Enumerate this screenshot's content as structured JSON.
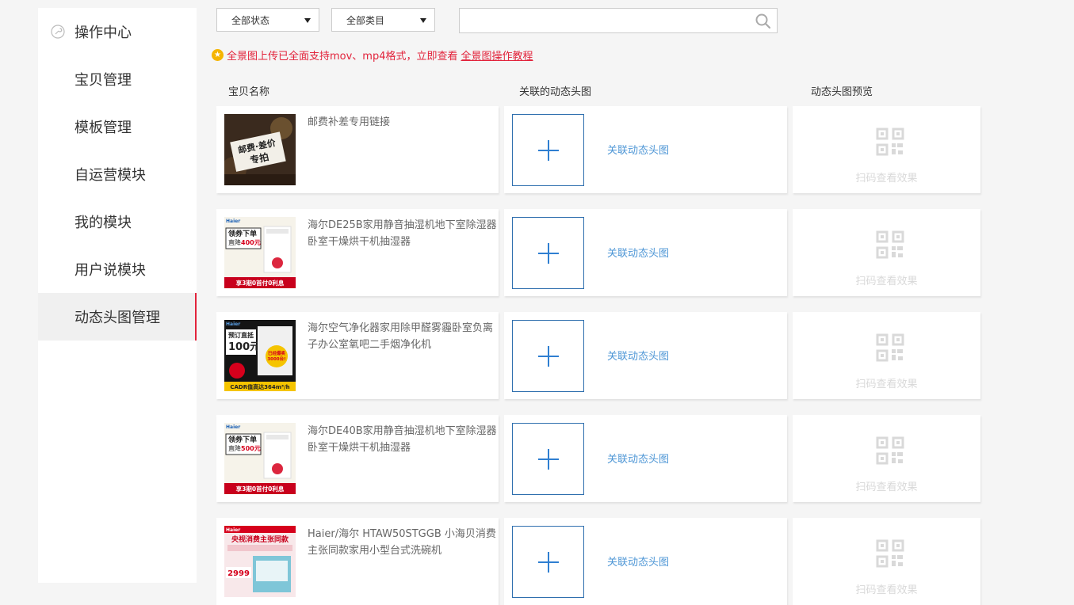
{
  "sidebar": {
    "items": [
      {
        "label": "操作中心"
      },
      {
        "label": "宝贝管理"
      },
      {
        "label": "模板管理"
      },
      {
        "label": "自运营模块"
      },
      {
        "label": "我的模块"
      },
      {
        "label": "用户说模块"
      },
      {
        "label": "动态头图管理"
      }
    ],
    "active_index": 6
  },
  "filters": {
    "status_select": "全部状态",
    "category_select": "全部类目",
    "search_placeholder": ""
  },
  "notice": {
    "text": "全景图上传已全面支持mov、mp4格式，立即查看",
    "link": "全景图操作教程"
  },
  "table": {
    "headers": [
      "宝贝名称",
      "关联的动态头图",
      "动态头图预览"
    ],
    "link_label": "关联动态头图",
    "preview_label": "扫码查看效果",
    "rows": [
      {
        "name": "邮费补差专用链接",
        "thumb": {
          "type": "postage",
          "line1": "邮费·差价",
          "line2": "专拍"
        }
      },
      {
        "name": "海尔DE25B家用静音抽湿机地下室除湿器卧室干燥烘干机抽湿器",
        "thumb": {
          "type": "dehumid",
          "brand": "Haier",
          "badge": "领券下单",
          "line2": "直降",
          "amount": "400元",
          "bottom": "享3期0首付0利息"
        }
      },
      {
        "name": "海尔空气净化器家用除甲醛雾霾卧室负离子办公室氧吧二手烟净化机",
        "thumb": {
          "type": "purifier",
          "brand": "Haier",
          "badge": "预订直抵",
          "amount": "100元",
          "sold": "已经爆卖3000台!",
          "bottom": "CADR值高达364m³/h"
        }
      },
      {
        "name": "海尔DE40B家用静音抽湿机地下室除湿器卧室干燥烘干机抽湿器",
        "thumb": {
          "type": "dehumid",
          "brand": "Haier",
          "badge": "领券下单",
          "line2": "直降",
          "amount": "500元",
          "bottom": "享3期0首付0利息"
        }
      },
      {
        "name": "Haier/海尔 HTAW50STGGB 小海贝消费主张同款家用小型台式洗碗机",
        "thumb": {
          "type": "dishwasher",
          "brand": "Haier",
          "headline": "央视消费主张同款",
          "price": "2999"
        }
      }
    ]
  },
  "colors": {
    "accent": "#e2233b",
    "link": "#4f97d6",
    "plus": "#2f7fd1",
    "background": "#f5f5f5"
  }
}
